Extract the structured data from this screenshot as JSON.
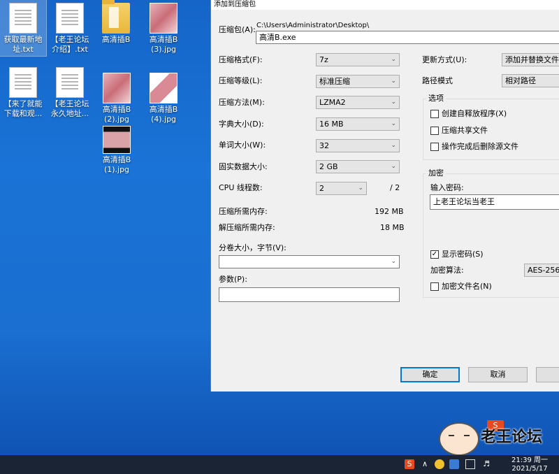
{
  "desktop": {
    "icons": [
      {
        "label_1": "获取最新地",
        "label_2": "址.txt"
      },
      {
        "label_1": "【老王论坛",
        "label_2": "介绍】.txt"
      },
      {
        "label_1": "高清插B",
        "label_2": ""
      },
      {
        "label_1": "高清插B",
        "label_2": "(3).jpg"
      },
      {
        "label_1": "【来了就能",
        "label_2": "下载和观..."
      },
      {
        "label_1": "【老王论坛",
        "label_2": "永久地址..."
      },
      {
        "label_1": "高清插B",
        "label_2": "(2).jpg"
      },
      {
        "label_1": "高清插B",
        "label_2": "(4).jpg"
      },
      {
        "label_1": "高清插B",
        "label_2": "(1).jpg"
      }
    ]
  },
  "dialog": {
    "title": "添加到压缩包",
    "archive_label": "压缩包(A):",
    "archive_path": "C:\\Users\\Administrator\\Desktop\\",
    "archive_name": "高清B.exe",
    "format_label": "压缩格式(F):",
    "format_value": "7z",
    "level_label": "压缩等级(L):",
    "level_value": "标准压缩",
    "method_label": "压缩方法(M):",
    "method_value": "LZMA2",
    "dict_label": "字典大小(D):",
    "dict_value": "16 MB",
    "word_label": "单词大小(W):",
    "word_value": "32",
    "solid_label": "固实数据大小:",
    "solid_value": "2 GB",
    "threads_label": "CPU 线程数:",
    "threads_value": "2",
    "threads_max": "/ 2",
    "mem_comp_label": "压缩所需内存:",
    "mem_comp_value": "192 MB",
    "mem_decomp_label": "解压缩所需内存:",
    "mem_decomp_value": "18 MB",
    "volume_label": "分卷大小，字节(V):",
    "volume_value": "",
    "params_label": "参数(P):",
    "params_value": "",
    "update_label": "更新方式(U):",
    "update_value": "添加并替换文件",
    "path_label": "路径模式",
    "path_value": "相对路径",
    "options_title": "选项",
    "opt_sfx": "创建自释放程序(X)",
    "opt_shared": "压缩共享文件",
    "opt_delete": "操作完成后删除源文件",
    "encrypt_title": "加密",
    "password_label": "输入密码:",
    "password_value": "上老王论坛当老王",
    "show_password": "显示密码(S)",
    "show_password_check": "✓",
    "enc_method_label": "加密算法:",
    "enc_method_value": "AES-256",
    "encrypt_names": "加密文件名(N)",
    "ok_button": "确定",
    "cancel_button": "取消"
  },
  "watermark": {
    "text": "老王论坛",
    "logo_letter": "S"
  },
  "taskbar": {
    "time": "21:39 周一",
    "date": "2021/5/17",
    "tray_chevron": "∧",
    "ime_letter": "S"
  }
}
